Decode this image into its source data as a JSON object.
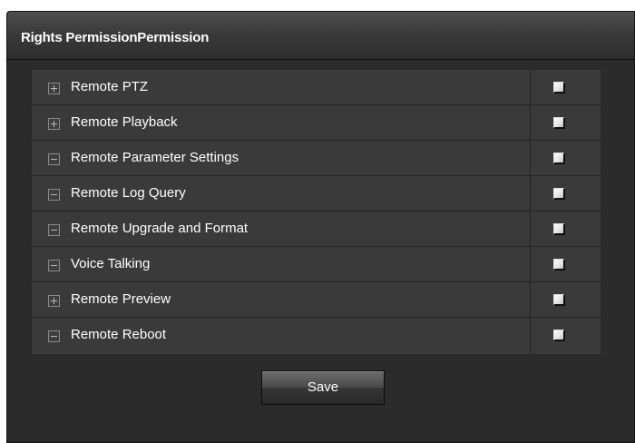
{
  "panel": {
    "title": "Rights PermissionPermission"
  },
  "permissions": [
    {
      "label": "Remote PTZ",
      "expand_icon": "plus-box-icon",
      "checked": false
    },
    {
      "label": "Remote Playback",
      "expand_icon": "plus-box-icon",
      "checked": false
    },
    {
      "label": "Remote Parameter Settings",
      "expand_icon": "minus-box-icon",
      "checked": false
    },
    {
      "label": "Remote Log Query",
      "expand_icon": "minus-box-icon",
      "checked": false
    },
    {
      "label": "Remote Upgrade and Format",
      "expand_icon": "minus-box-icon",
      "checked": false
    },
    {
      "label": "Voice Talking",
      "expand_icon": "minus-box-icon",
      "checked": false
    },
    {
      "label": "Remote Preview",
      "expand_icon": "plus-box-icon",
      "checked": false
    },
    {
      "label": "Remote Reboot",
      "expand_icon": "minus-box-icon",
      "checked": false
    }
  ],
  "actions": {
    "save_label": "Save"
  },
  "colors": {
    "panel_background": "#2b2b2b",
    "table_background": "#3a3a3a",
    "text": "#ffffff"
  }
}
